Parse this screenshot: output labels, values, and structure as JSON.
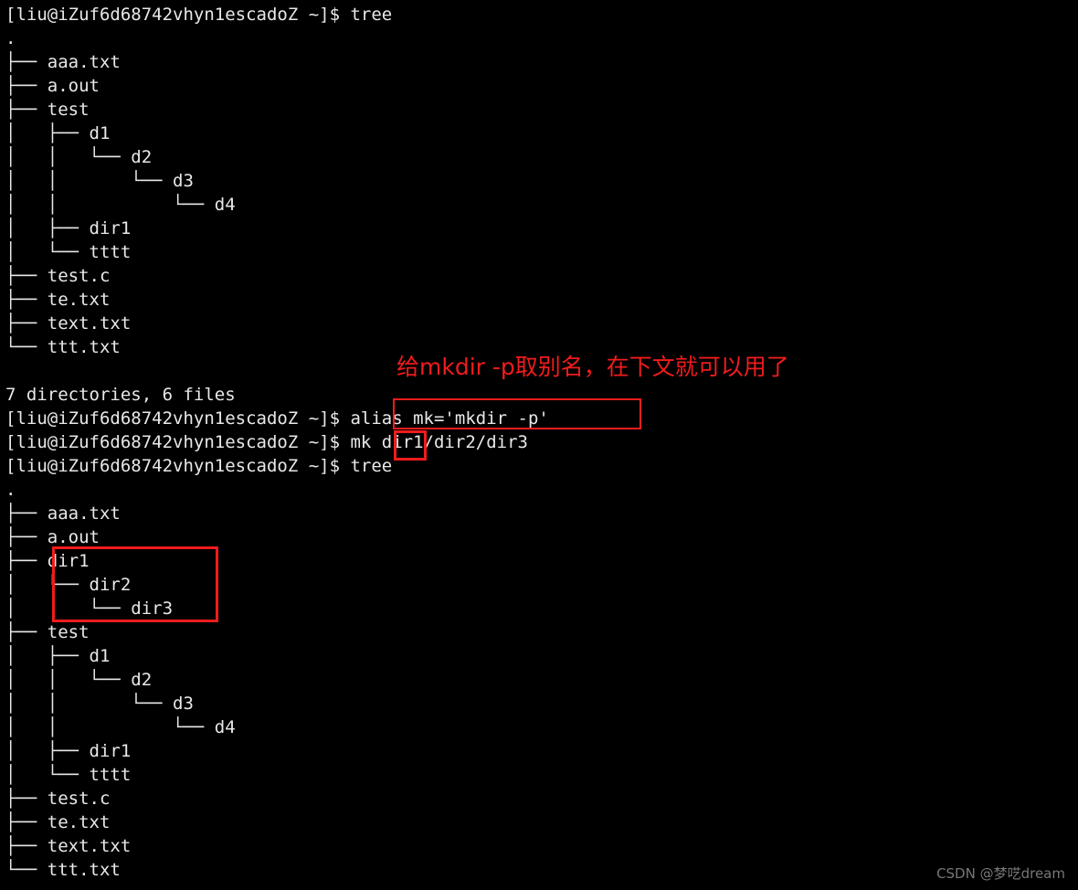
{
  "terminal": {
    "prompt": "[liu@iZuf6d68742vhyn1escadoZ ~]$ ",
    "background_color": "#000000",
    "text_color": "#e8e8e8",
    "annotation_color": "#f01c1c",
    "lines": [
      "[liu@iZuf6d68742vhyn1escadoZ ~]$ tree",
      ".",
      "├── aaa.txt",
      "├── a.out",
      "├── test",
      "│   ├── d1",
      "│   │   └── d2",
      "│   │       └── d3",
      "│   │           └── d4",
      "│   ├── dir1",
      "│   └── tttt",
      "├── test.c",
      "├── te.txt",
      "├── text.txt",
      "└── ttt.txt",
      "",
      "7 directories, 6 files",
      "[liu@iZuf6d68742vhyn1escadoZ ~]$ alias mk='mkdir -p'",
      "[liu@iZuf6d68742vhyn1escadoZ ~]$ mk dir1/dir2/dir3",
      "[liu@iZuf6d68742vhyn1escadoZ ~]$ tree",
      ".",
      "├── aaa.txt",
      "├── a.out",
      "├── dir1",
      "│   └── dir2",
      "│       └── dir3",
      "├── test",
      "│   ├── d1",
      "│   │   └── d2",
      "│   │       └── d3",
      "│   │           └── d4",
      "│   ├── dir1",
      "│   └── tttt",
      "├── test.c",
      "├── te.txt",
      "├── text.txt",
      "└── ttt.txt"
    ],
    "commands": {
      "tree_first": "tree",
      "alias_command": "alias mk='mkdir -p'",
      "mk_command": "mk dir1/dir2/dir3",
      "tree_second": "tree",
      "alias_name": "mk"
    },
    "summary_first": "7 directories, 6 files"
  },
  "annotation": {
    "text": "给mkdir -p取别名，在下文就可以用了"
  },
  "highlight_boxes": {
    "alias_box_label": "alias mk='mkdir -p'",
    "mk_box_label": "mk",
    "dirs_box_label": "dir1 dir2 dir3"
  },
  "watermark": {
    "text": "CSDN @梦呓dream"
  }
}
